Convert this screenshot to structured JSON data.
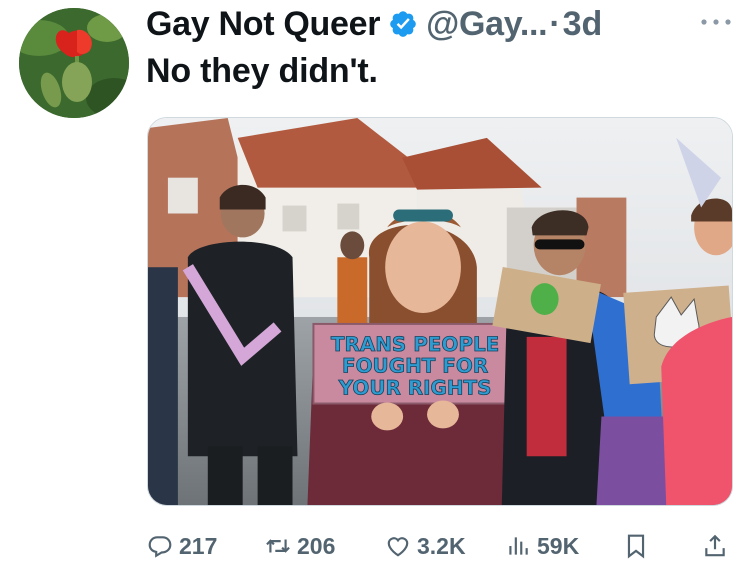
{
  "tweet": {
    "display_name": "Gay Not Queer",
    "handle": "@Gay...",
    "separator": "·",
    "time": "3d",
    "text": "No they didn't.",
    "verified": true
  },
  "media": {
    "sign_text": [
      "TRANS PEOPLE",
      "FOUGHT FOR",
      "YOUR RIGHTS"
    ]
  },
  "actions": {
    "replies": "217",
    "retweets": "206",
    "likes": "3.2K",
    "views": "59K"
  },
  "colors": {
    "verified_blue": "#1d9bf0",
    "secondary_text": "#536471",
    "sign_text": "#2e9bd1",
    "sign_board": "#c98aa0"
  },
  "icons": {
    "avatar": "poppy-flower-avatar",
    "verified": "verified-badge-icon",
    "more": "more-icon",
    "reply": "reply-icon",
    "retweet": "retweet-icon",
    "like": "heart-icon",
    "views": "views-icon",
    "bookmark": "bookmark-icon",
    "share": "share-icon"
  }
}
